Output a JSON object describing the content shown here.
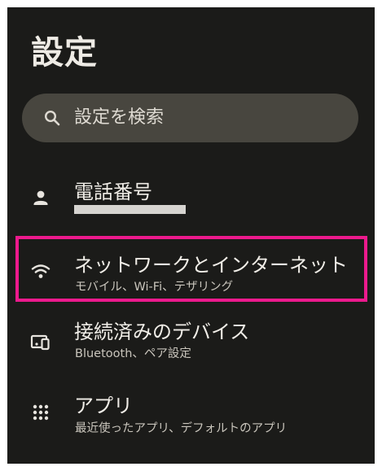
{
  "header": {
    "title": "設定"
  },
  "search": {
    "placeholder": "設定を検索",
    "icon": "search-icon"
  },
  "items": [
    {
      "title": "電話番号",
      "subtitle": "",
      "icon": "person-icon",
      "subtitle_redacted": true
    },
    {
      "title": "ネットワークとインターネット",
      "subtitle": "モバイル、Wi-Fi、テザリング",
      "icon": "wifi-icon",
      "highlighted": true
    },
    {
      "title": "接続済みのデバイス",
      "subtitle": "Bluetooth、ペア設定",
      "icon": "devices-icon"
    },
    {
      "title": "アプリ",
      "subtitle": "最近使ったアプリ、デフォルトのアプリ",
      "icon": "apps-grid-icon"
    }
  ],
  "colors": {
    "background": "#1b1b19",
    "search_bar": "#48463f",
    "highlight": "#ec1a8d",
    "text_primary": "#f0ede7",
    "text_secondary": "#c9c5bc"
  }
}
